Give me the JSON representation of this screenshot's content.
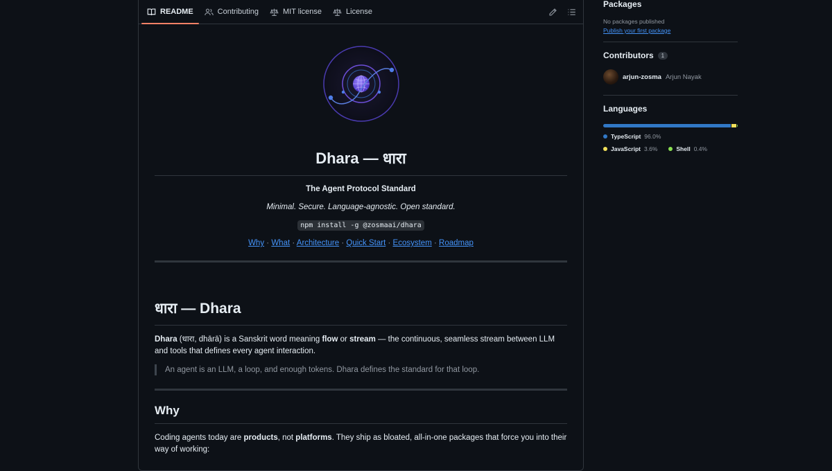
{
  "tabs": [
    {
      "label": "README",
      "icon": "book-icon",
      "active": true
    },
    {
      "label": "Contributing",
      "icon": "people-icon",
      "active": false
    },
    {
      "label": "MIT license",
      "icon": "law-icon",
      "active": false
    },
    {
      "label": "License",
      "icon": "law-icon",
      "active": false
    }
  ],
  "readme": {
    "title": "Dhara — धारा",
    "tagline": "The Agent Protocol Standard",
    "subtitle": "Minimal. Secure. Language-agnostic. Open standard.",
    "install_cmd": "npm install -g @zosmaai/dhara",
    "nav_links": [
      "Why",
      "What",
      "Architecture",
      "Quick Start",
      "Ecosystem",
      "Roadmap"
    ],
    "nav_sep": "·",
    "section1_heading": "धारा — Dhara",
    "intro": {
      "b1": "Dhara",
      "t1": " (धारा, dhārā) is a Sanskrit word meaning ",
      "b2": "flow",
      "t2": " or ",
      "b3": "stream",
      "t3": " — the continuous, seamless stream between LLM and tools that defines every agent interaction."
    },
    "quote": "An agent is an LLM, a loop, and enough tokens. Dhara defines the standard for that loop.",
    "section2_heading": "Why",
    "why": {
      "t1": "Coding agents today are ",
      "b1": "products",
      "t2": ", not ",
      "b2": "platforms",
      "t3": ". They ship as bloated, all-in-one packages that force you into their way of working:"
    }
  },
  "sidebar": {
    "packages": {
      "heading": "Packages",
      "empty_text": "No packages published",
      "link": "Publish your first package"
    },
    "contributors": {
      "heading": "Contributors",
      "count": "1",
      "items": [
        {
          "login": "arjun-zosma",
          "name": "Arjun Nayak"
        }
      ]
    },
    "languages": {
      "heading": "Languages",
      "items": [
        {
          "name": "TypeScript",
          "percent": "96.0%",
          "value": 96.0,
          "color": "#3178c6"
        },
        {
          "name": "JavaScript",
          "percent": "3.6%",
          "value": 3.6,
          "color": "#f1e05a"
        },
        {
          "name": "Shell",
          "percent": "0.4%",
          "value": 0.4,
          "color": "#89e051"
        }
      ]
    }
  },
  "colors": {
    "background": "#0d1117",
    "border": "#30363d",
    "link": "#4493f8",
    "muted": "#9198a1",
    "tab_underline": "#f78166",
    "logo_purple": "#6c4ed8"
  }
}
